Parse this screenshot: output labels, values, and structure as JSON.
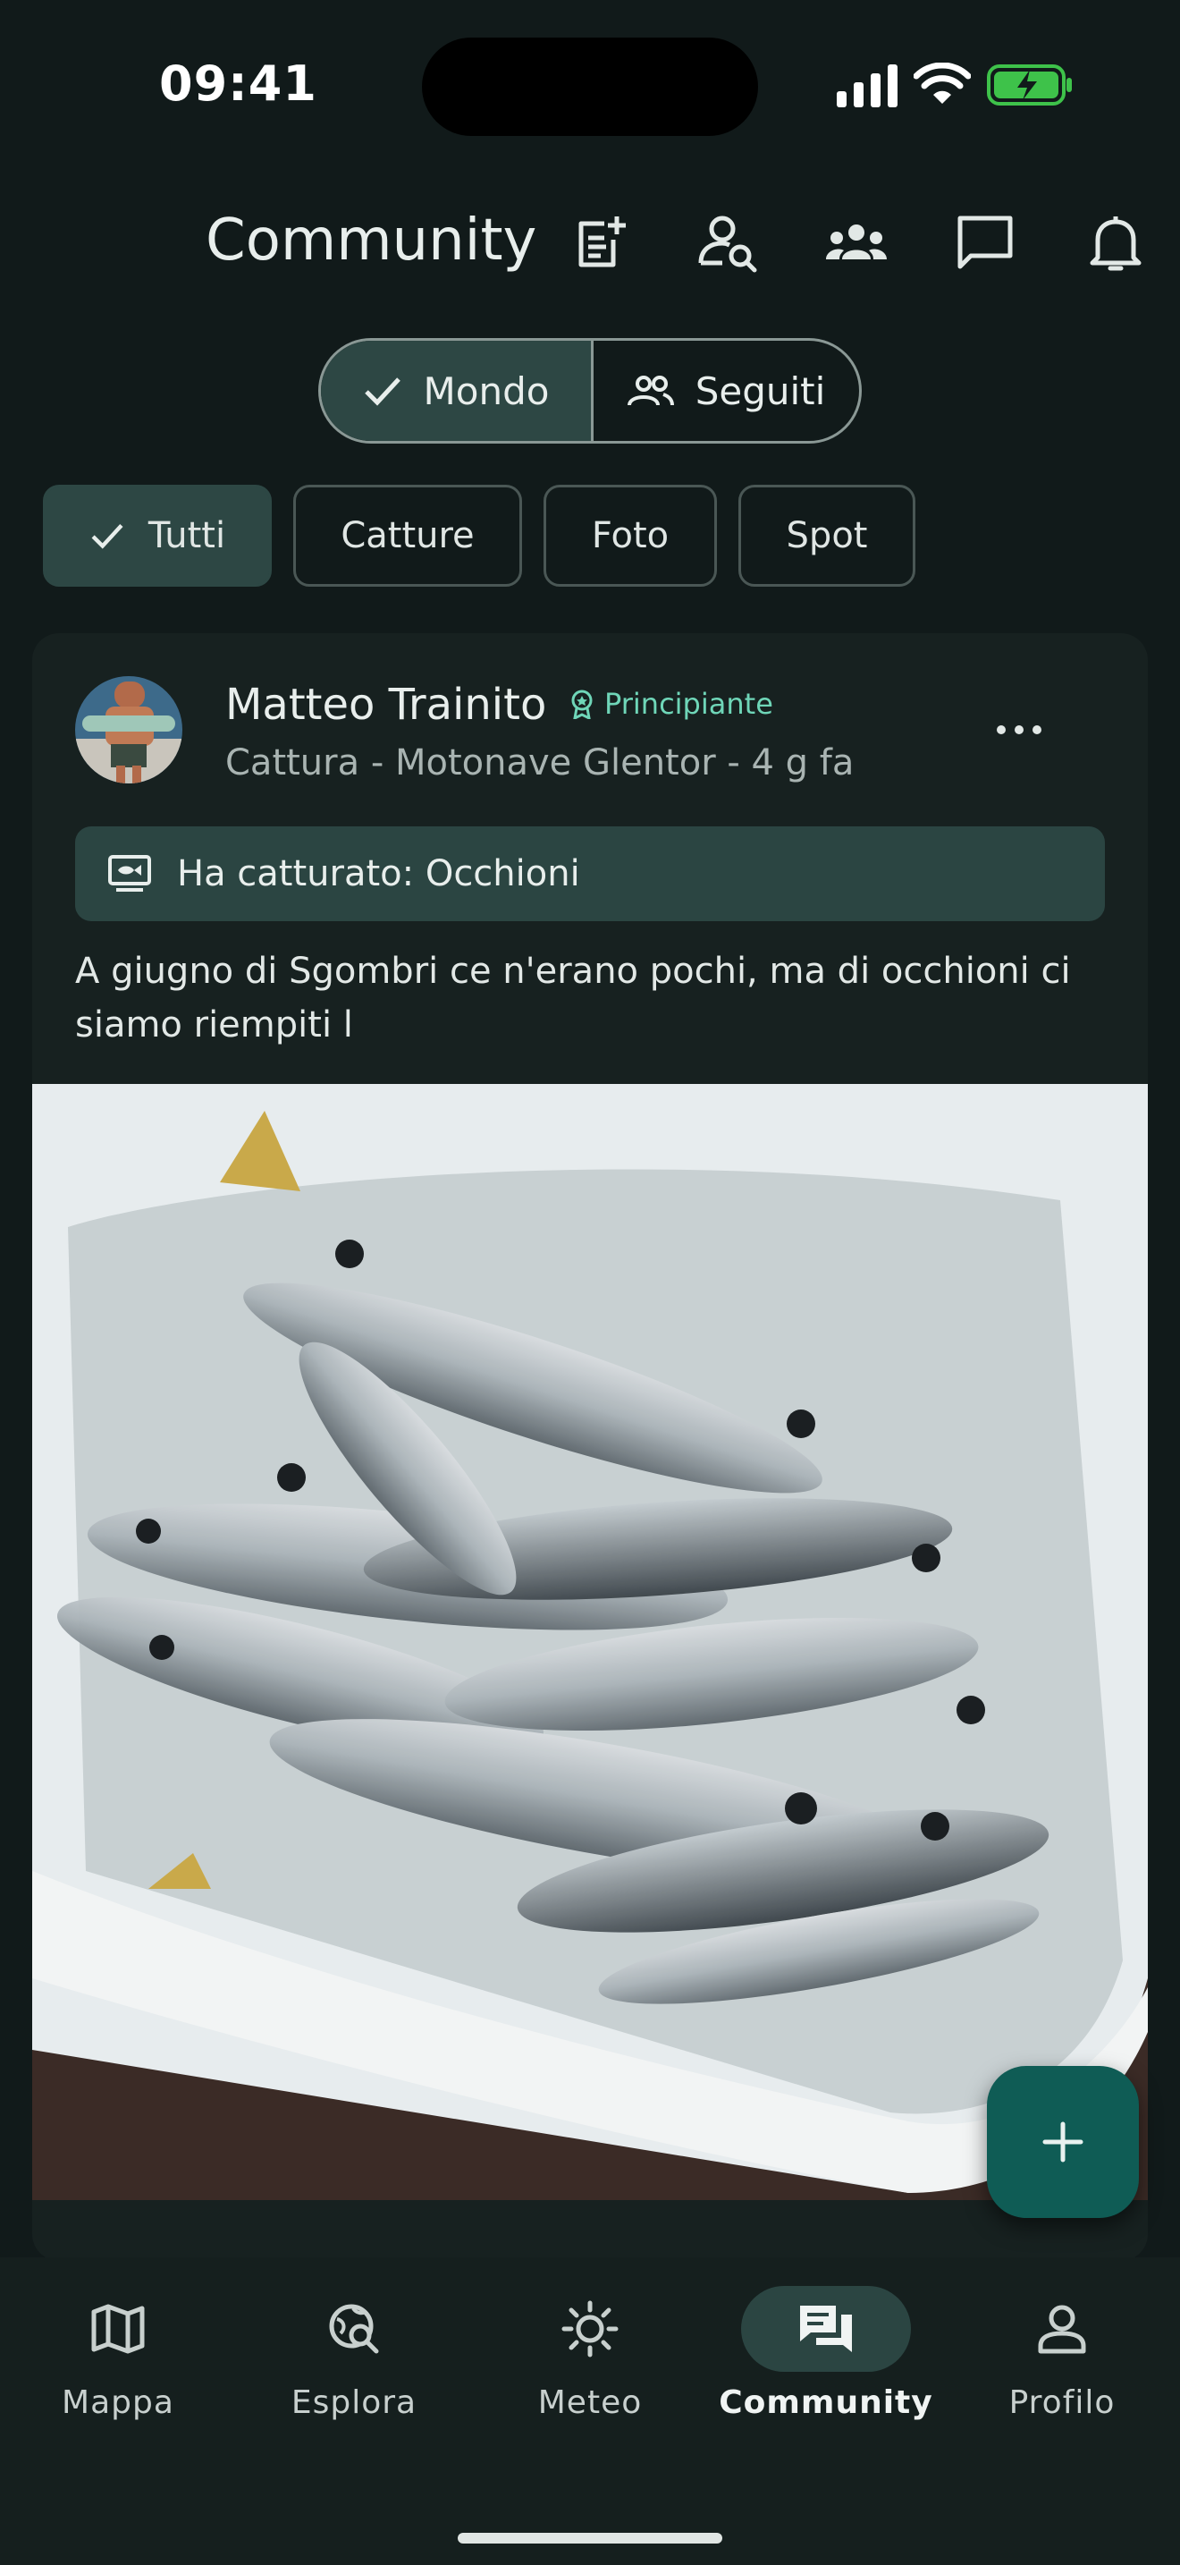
{
  "status_bar": {
    "time": "09:41"
  },
  "header": {
    "title": "Community",
    "icons": [
      "new-post-icon",
      "find-user-icon",
      "groups-icon",
      "chat-icon",
      "bell-icon"
    ]
  },
  "segment": {
    "items": [
      {
        "label": "Mondo",
        "selected": true
      },
      {
        "label": "Seguiti",
        "selected": false
      }
    ]
  },
  "filters": {
    "chips": [
      {
        "label": "Tutti",
        "selected": true
      },
      {
        "label": "Catture",
        "selected": false
      },
      {
        "label": "Foto",
        "selected": false
      },
      {
        "label": "Spot",
        "selected": false
      }
    ]
  },
  "post": {
    "author": "Matteo Trainito",
    "badge": "Principiante",
    "meta": "Cattura - Motonave Glentor - 4 g fa",
    "catch_label": "Ha catturato: Occhioni",
    "caption": "A giugno di Sgombri ce n'erano pochi, ma di occhioni ci siamo riempiti l"
  },
  "bottom_nav": {
    "items": [
      {
        "label": "Mappa",
        "icon": "map-icon",
        "active": false
      },
      {
        "label": "Esplora",
        "icon": "explore-icon",
        "active": false
      },
      {
        "label": "Meteo",
        "icon": "weather-icon",
        "active": false
      },
      {
        "label": "Community",
        "icon": "community-icon",
        "active": true
      },
      {
        "label": "Profilo",
        "icon": "profile-icon",
        "active": false
      }
    ]
  },
  "colors": {
    "background": "#111a1a",
    "accent": "#2d4744",
    "fab": "#0f5c55",
    "badge": "#6fd6b8"
  }
}
